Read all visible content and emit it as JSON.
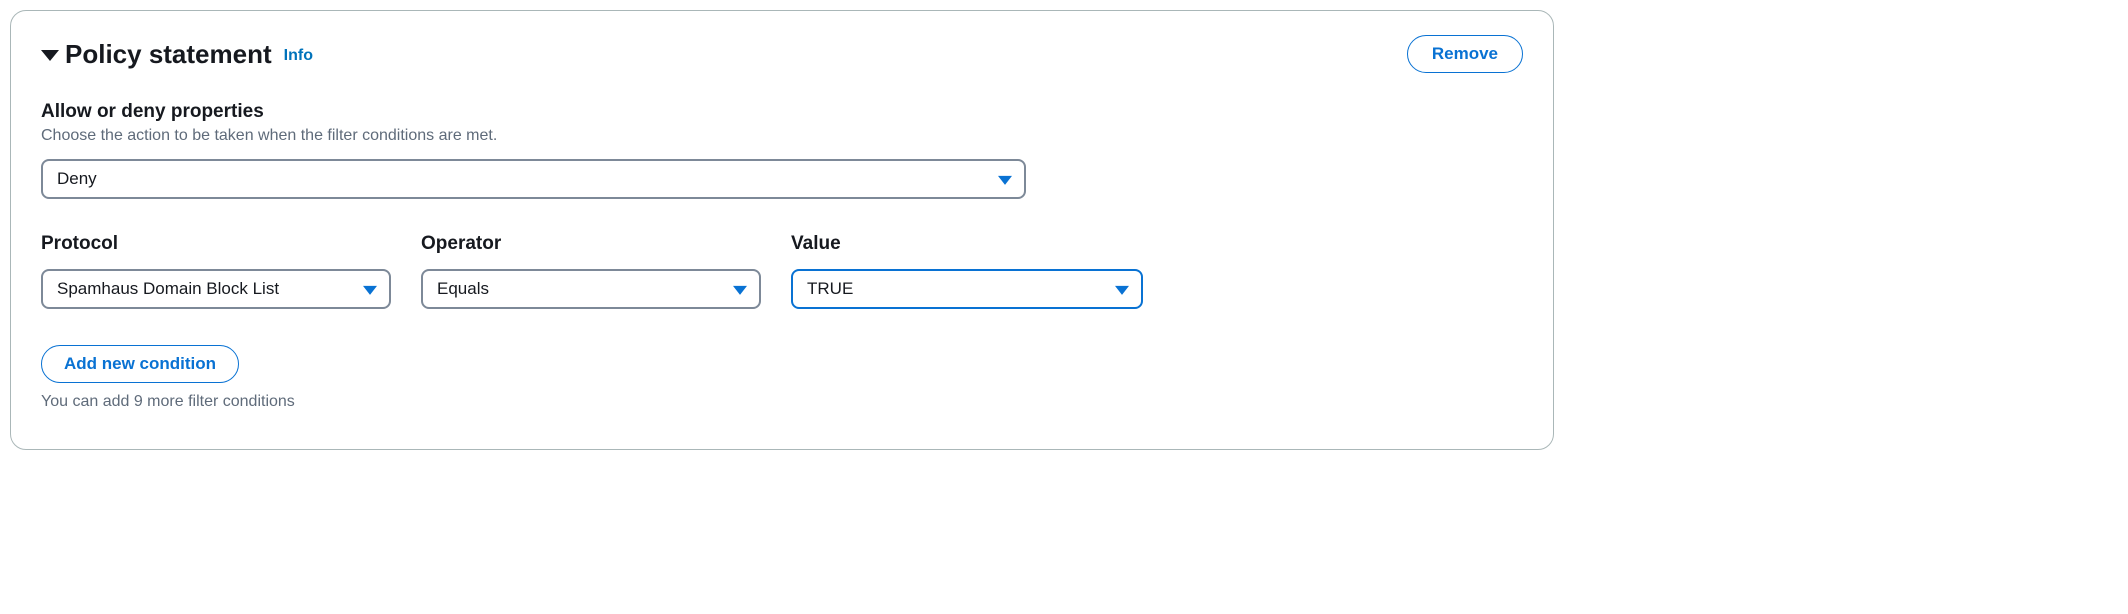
{
  "header": {
    "title": "Policy statement",
    "info_link": "Info",
    "remove_label": "Remove"
  },
  "action_section": {
    "label": "Allow or deny properties",
    "description": "Choose the action to be taken when the filter conditions are met.",
    "selected": "Deny"
  },
  "filters": {
    "protocol": {
      "label": "Protocol",
      "selected": "Spamhaus Domain Block List"
    },
    "operator": {
      "label": "Operator",
      "selected": "Equals"
    },
    "value": {
      "label": "Value",
      "selected": "TRUE"
    }
  },
  "add_condition": {
    "button_label": "Add new condition",
    "limit_text": "You can add 9 more filter conditions"
  }
}
